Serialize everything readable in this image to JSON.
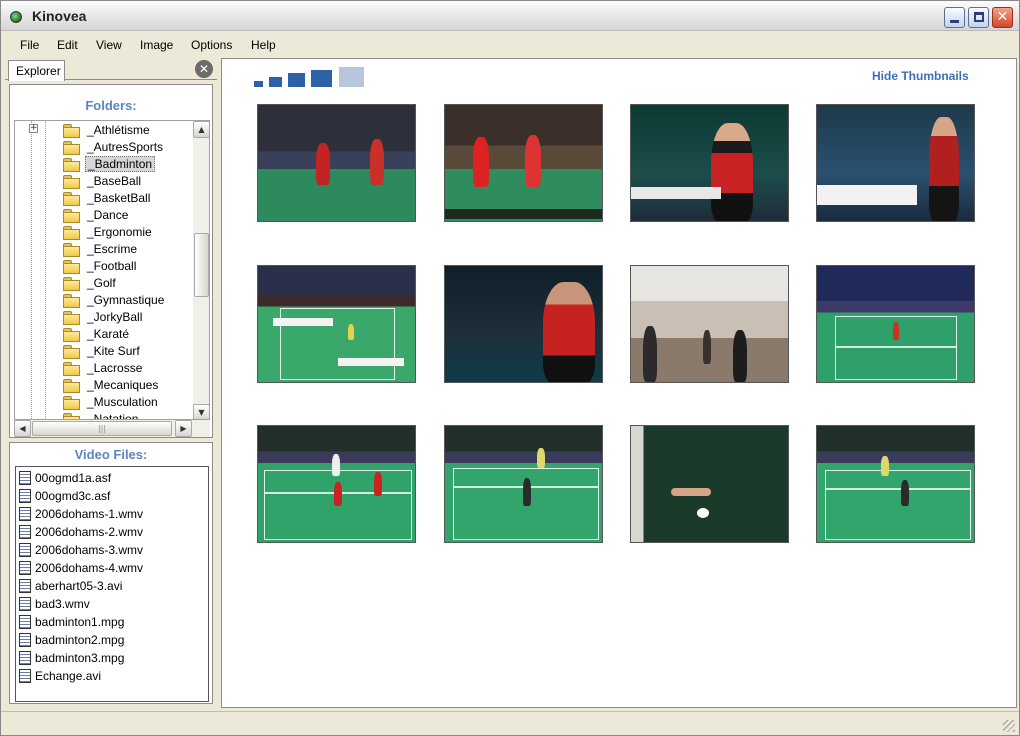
{
  "window": {
    "title": "Kinovea"
  },
  "menu": [
    "File",
    "Edit",
    "View",
    "Image",
    "Options",
    "Help"
  ],
  "left_panel": {
    "tab": "Explorer",
    "folders_title": "Folders:",
    "folders": [
      {
        "label": "_Athlétisme",
        "expander": "+"
      },
      {
        "label": "_AutresSports"
      },
      {
        "label": "_Badminton",
        "selected": true
      },
      {
        "label": "_BaseBall"
      },
      {
        "label": "_BasketBall"
      },
      {
        "label": "_Dance"
      },
      {
        "label": "_Ergonomie"
      },
      {
        "label": "_Escrime"
      },
      {
        "label": "_Football"
      },
      {
        "label": "_Golf"
      },
      {
        "label": "_Gymnastique"
      },
      {
        "label": "_JorkyBall"
      },
      {
        "label": "_Karaté"
      },
      {
        "label": "_Kite Surf"
      },
      {
        "label": "_Lacrosse"
      },
      {
        "label": "_Mecaniques"
      },
      {
        "label": "_Musculation"
      },
      {
        "label": "_Natation"
      }
    ],
    "files_title": "Video Files:",
    "files": [
      "00ogmd1a.asf",
      "00ogmd3c.asf",
      "2006dohams-1.wmv",
      "2006dohams-2.wmv",
      "2006dohams-3.wmv",
      "2006dohams-4.wmv",
      "aberhart05-3.avi",
      "bad3.wmv",
      "badminton1.mpg",
      "badminton2.mpg",
      "badminton3.mpg",
      "Echange.avi"
    ]
  },
  "main": {
    "hide_thumbnails": "Hide Thumbnails",
    "thumbnail_count": 12
  },
  "colors": {
    "accent": "#3e6fb5",
    "size_buttons": "#2e62a8",
    "section_title": "#5b86c0"
  }
}
